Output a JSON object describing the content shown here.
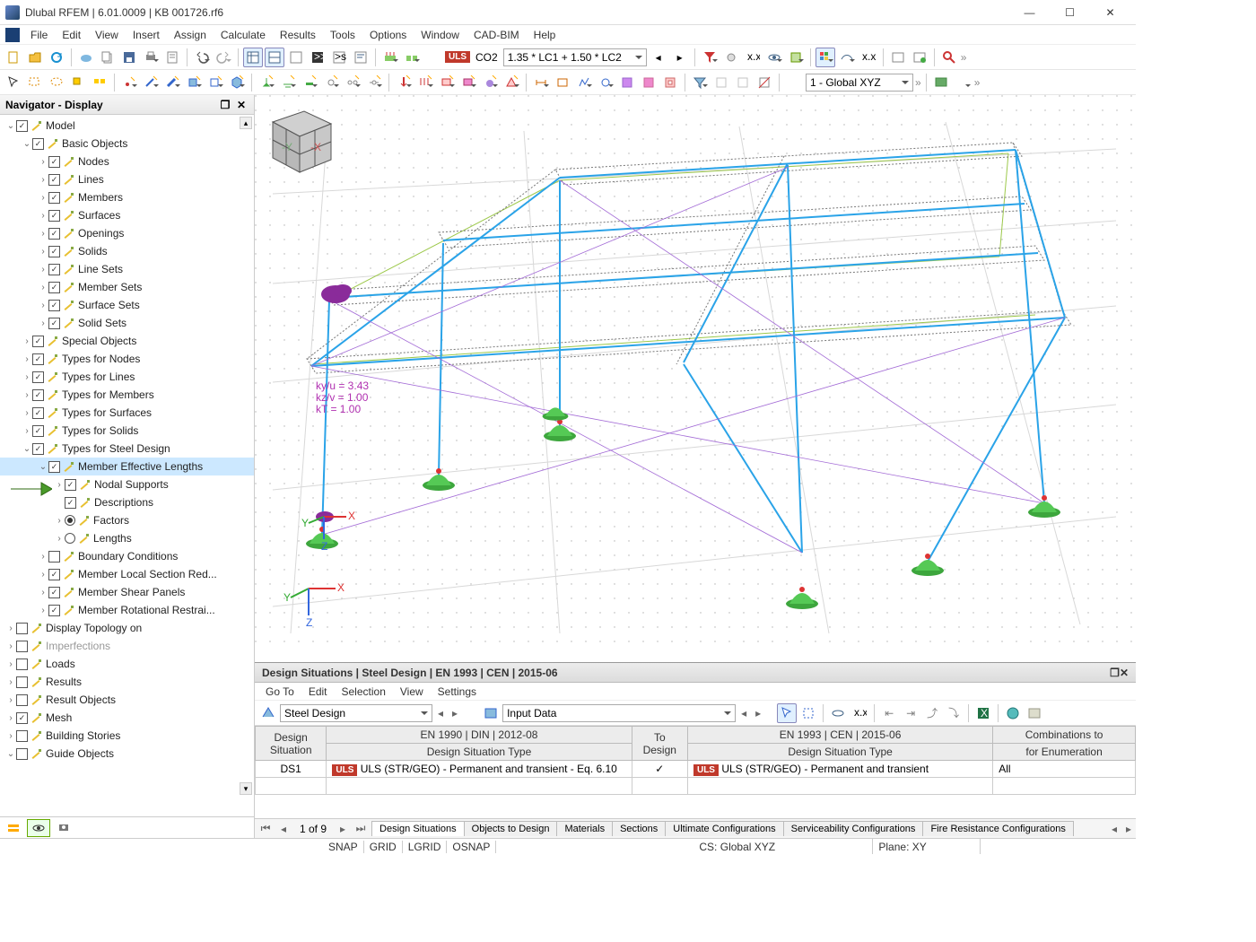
{
  "window": {
    "title": "Dlubal RFEM | 6.01.0009 | KB 001726.rf6",
    "minimize": "—",
    "maximize": "☐",
    "close": "✕"
  },
  "menu": [
    "File",
    "Edit",
    "View",
    "Insert",
    "Assign",
    "Calculate",
    "Results",
    "Tools",
    "Options",
    "Window",
    "CAD-BIM",
    "Help"
  ],
  "toolbar1": {
    "uls_badge": "ULS",
    "combo_label": "CO2",
    "combo_formula": "1.35 * LC1 + 1.50 * LC2",
    "coord_combo": "1 - Global XYZ"
  },
  "navigator": {
    "title": "Navigator - Display",
    "tree": [
      {
        "lvl": 0,
        "exp": "v",
        "chk": true,
        "icon": "brush",
        "label": "Model"
      },
      {
        "lvl": 1,
        "exp": "v",
        "chk": true,
        "icon": "brush",
        "label": "Basic Objects"
      },
      {
        "lvl": 2,
        "exp": ">",
        "chk": true,
        "icon": "brush",
        "label": "Nodes"
      },
      {
        "lvl": 2,
        "exp": ">",
        "chk": true,
        "icon": "brush",
        "label": "Lines"
      },
      {
        "lvl": 2,
        "exp": ">",
        "chk": true,
        "icon": "brush",
        "label": "Members"
      },
      {
        "lvl": 2,
        "exp": ">",
        "chk": true,
        "icon": "brush",
        "label": "Surfaces"
      },
      {
        "lvl": 2,
        "exp": ">",
        "chk": true,
        "icon": "brush",
        "label": "Openings"
      },
      {
        "lvl": 2,
        "exp": ">",
        "chk": true,
        "icon": "brush",
        "label": "Solids"
      },
      {
        "lvl": 2,
        "exp": ">",
        "chk": true,
        "icon": "brush",
        "label": "Line Sets"
      },
      {
        "lvl": 2,
        "exp": ">",
        "chk": true,
        "icon": "brush",
        "label": "Member Sets"
      },
      {
        "lvl": 2,
        "exp": ">",
        "chk": true,
        "icon": "brush",
        "label": "Surface Sets"
      },
      {
        "lvl": 2,
        "exp": ">",
        "chk": true,
        "icon": "brush",
        "label": "Solid Sets"
      },
      {
        "lvl": 1,
        "exp": ">",
        "chk": true,
        "icon": "brush",
        "label": "Special Objects"
      },
      {
        "lvl": 1,
        "exp": ">",
        "chk": true,
        "icon": "brush",
        "label": "Types for Nodes"
      },
      {
        "lvl": 1,
        "exp": ">",
        "chk": true,
        "icon": "brush",
        "label": "Types for Lines"
      },
      {
        "lvl": 1,
        "exp": ">",
        "chk": true,
        "icon": "brush",
        "label": "Types for Members"
      },
      {
        "lvl": 1,
        "exp": ">",
        "chk": true,
        "icon": "brush",
        "label": "Types for Surfaces"
      },
      {
        "lvl": 1,
        "exp": ">",
        "chk": true,
        "icon": "brush",
        "label": "Types for Solids"
      },
      {
        "lvl": 1,
        "exp": "v",
        "chk": true,
        "icon": "brush",
        "label": "Types for Steel Design"
      },
      {
        "lvl": 2,
        "exp": "v",
        "chk": true,
        "icon": "brush",
        "label": "Member Effective Lengths",
        "sel": true
      },
      {
        "lvl": 3,
        "exp": ">",
        "chk": true,
        "icon": "brush",
        "label": "Nodal Supports"
      },
      {
        "lvl": 3,
        "exp": "",
        "chk": true,
        "icon": "brush",
        "label": "Descriptions"
      },
      {
        "lvl": 3,
        "exp": ">",
        "radio": "on",
        "icon": "brush",
        "label": "Factors"
      },
      {
        "lvl": 3,
        "exp": ">",
        "radio": "off",
        "icon": "brush",
        "label": "Lengths"
      },
      {
        "lvl": 2,
        "exp": ">",
        "chk": false,
        "icon": "brush",
        "label": "Boundary Conditions"
      },
      {
        "lvl": 2,
        "exp": ">",
        "chk": true,
        "icon": "brush",
        "label": "Member Local Section Red..."
      },
      {
        "lvl": 2,
        "exp": ">",
        "chk": true,
        "icon": "brush",
        "label": "Member Shear Panels"
      },
      {
        "lvl": 2,
        "exp": ">",
        "chk": true,
        "icon": "brush",
        "label": "Member Rotational Restrai..."
      },
      {
        "lvl": 0,
        "exp": ">",
        "chk": false,
        "icon": "brush",
        "label": "Display Topology on"
      },
      {
        "lvl": 0,
        "exp": ">",
        "chk": false,
        "icon": "imp",
        "label": "Imperfections",
        "dis": true
      },
      {
        "lvl": 0,
        "exp": ">",
        "chk": false,
        "icon": "load",
        "label": "Loads"
      },
      {
        "lvl": 0,
        "exp": ">",
        "chk": false,
        "icon": "res",
        "label": "Results"
      },
      {
        "lvl": 0,
        "exp": ">",
        "chk": false,
        "icon": "res",
        "label": "Result Objects"
      },
      {
        "lvl": 0,
        "exp": ">",
        "chk": true,
        "icon": "mesh",
        "label": "Mesh"
      },
      {
        "lvl": 0,
        "exp": ">",
        "chk": false,
        "icon": "bldg",
        "label": "Building Stories"
      },
      {
        "lvl": 0,
        "exp": "v",
        "chk": false,
        "icon": "guide",
        "label": "Guide Objects"
      }
    ]
  },
  "viewport_labels": {
    "k1": "ky/u = 3.43",
    "k2": "kz/v = 1.00",
    "k3": "kT  = 1.00",
    "axes": {
      "x": "X",
      "y": "Y",
      "z": "Z"
    }
  },
  "bottom_panel": {
    "title": "Design Situations | Steel Design | EN 1993 | CEN | 2015-06",
    "menu": [
      "Go To",
      "Edit",
      "Selection",
      "View",
      "Settings"
    ],
    "combo_left": "Steel Design",
    "combo_right": "Input Data",
    "table": {
      "group_headers": [
        "Design Situation",
        "EN 1990 | DIN | 2012-08",
        "To Design",
        "EN 1993 | CEN | 2015-06",
        "Combinations to"
      ],
      "sub_headers": [
        "",
        "Design Situation Type",
        "",
        "Design Situation Type",
        "for Enumeration"
      ],
      "row": {
        "ds": "DS1",
        "badge1": "ULS",
        "type1": "ULS (STR/GEO) - Permanent and transient - Eq. 6.10",
        "to_design": "✓",
        "badge2": "ULS",
        "type2": "ULS (STR/GEO) - Permanent and transient",
        "combos": "All"
      }
    },
    "page_info": "1 of 9",
    "tabs": [
      "Design Situations",
      "Objects to Design",
      "Materials",
      "Sections",
      "Ultimate Configurations",
      "Serviceability Configurations",
      "Fire Resistance Configurations"
    ],
    "active_tab": 0
  },
  "statusbar": {
    "items": [
      "SNAP",
      "GRID",
      "LGRID",
      "OSNAP"
    ],
    "cs": "CS: Global XYZ",
    "plane": "Plane: XY"
  }
}
